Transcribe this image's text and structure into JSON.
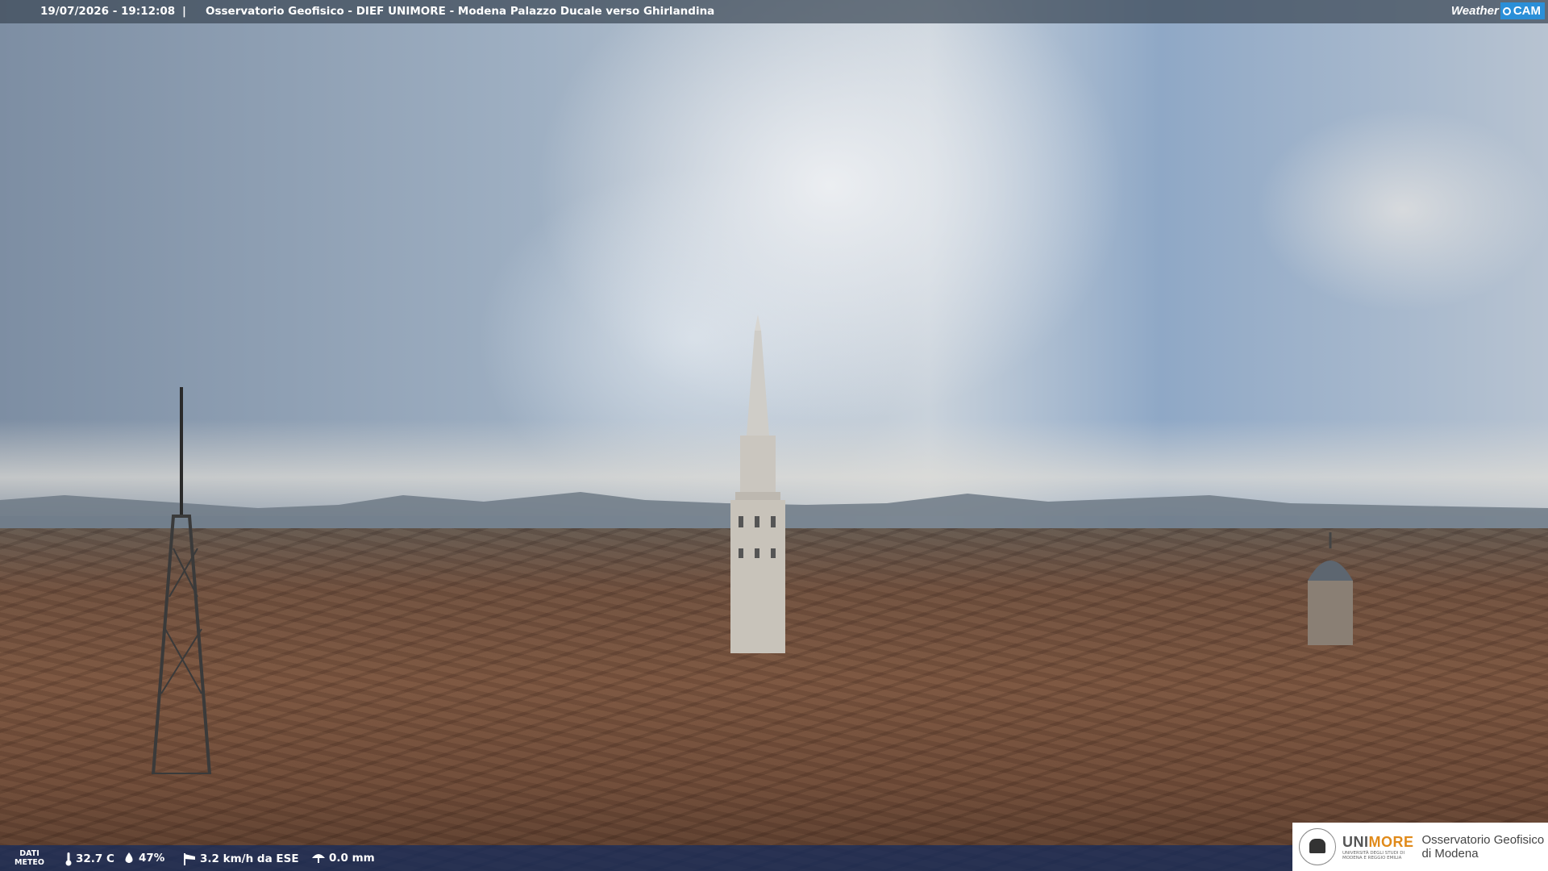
{
  "header": {
    "datetime": "19/07/2026 - 19:12:08",
    "separator": "|",
    "title": "Osservatorio Geofisico - DIEF UNIMORE - Modena Palazzo Ducale verso Ghirlandina",
    "brand_weather": "Weather",
    "brand_cam": "CAM"
  },
  "weather": {
    "label_line1": "DATI",
    "label_line2": "METEO",
    "temperature": "32.7 C",
    "temperature_icon": "thermometer-icon",
    "humidity": "47%",
    "humidity_icon": "drop-icon",
    "wind": "3.2 km/h da ESE",
    "wind_icon": "windsock-icon",
    "rain": "0.0 mm",
    "rain_icon": "umbrella-icon"
  },
  "logo": {
    "uni_prefix": "UNI",
    "uni_suffix": "MORE",
    "uni_subtitle": "UNIVERSITÀ DEGLI STUDI DI MODENA E REGGIO EMILIA",
    "obs_line1": "Osservatorio Geofisico",
    "obs_line2": "di Modena"
  },
  "colors": {
    "bottom_bar": "#142d5f",
    "brand_accent": "#2a8fd8",
    "unimore_accent": "#e08a1a"
  }
}
